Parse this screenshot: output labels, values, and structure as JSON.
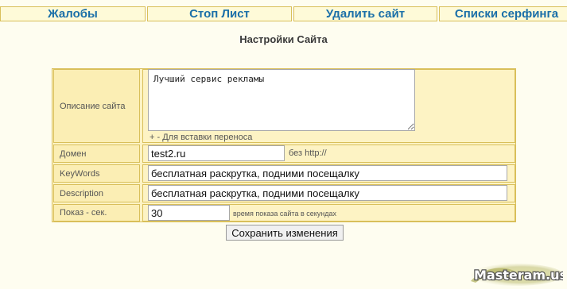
{
  "nav": {
    "tabs": [
      {
        "label": "Жалобы"
      },
      {
        "label": "Стоп Лист"
      },
      {
        "label": "Удалить сайт"
      },
      {
        "label": "Списки серфинга"
      }
    ]
  },
  "page_title": "Настройки Сайта",
  "form": {
    "description": {
      "label": "Описание сайта",
      "value": "Лучший сервис рекламы",
      "hint": "+ - Для вставки переноса"
    },
    "domain": {
      "label": "Домен",
      "value": "test2.ru",
      "note": "без http://"
    },
    "keywords": {
      "label": "KeyWords",
      "value": "бесплатная раскрутка, подними посещалку"
    },
    "meta_description": {
      "label": "Description",
      "value": "бесплатная раскрутка, подними посещалку"
    },
    "show_seconds": {
      "label": "Показ - сек.",
      "value": "30",
      "note": "время показа сайта в секундах"
    },
    "submit_label": "Сохранить изменения"
  },
  "watermark": {
    "text": "Masteram.us"
  },
  "colors": {
    "tab_text": "#1a6fa8",
    "border": "#d9bf5a",
    "panel": "#fdf3c4",
    "background": "#fefdf0"
  }
}
